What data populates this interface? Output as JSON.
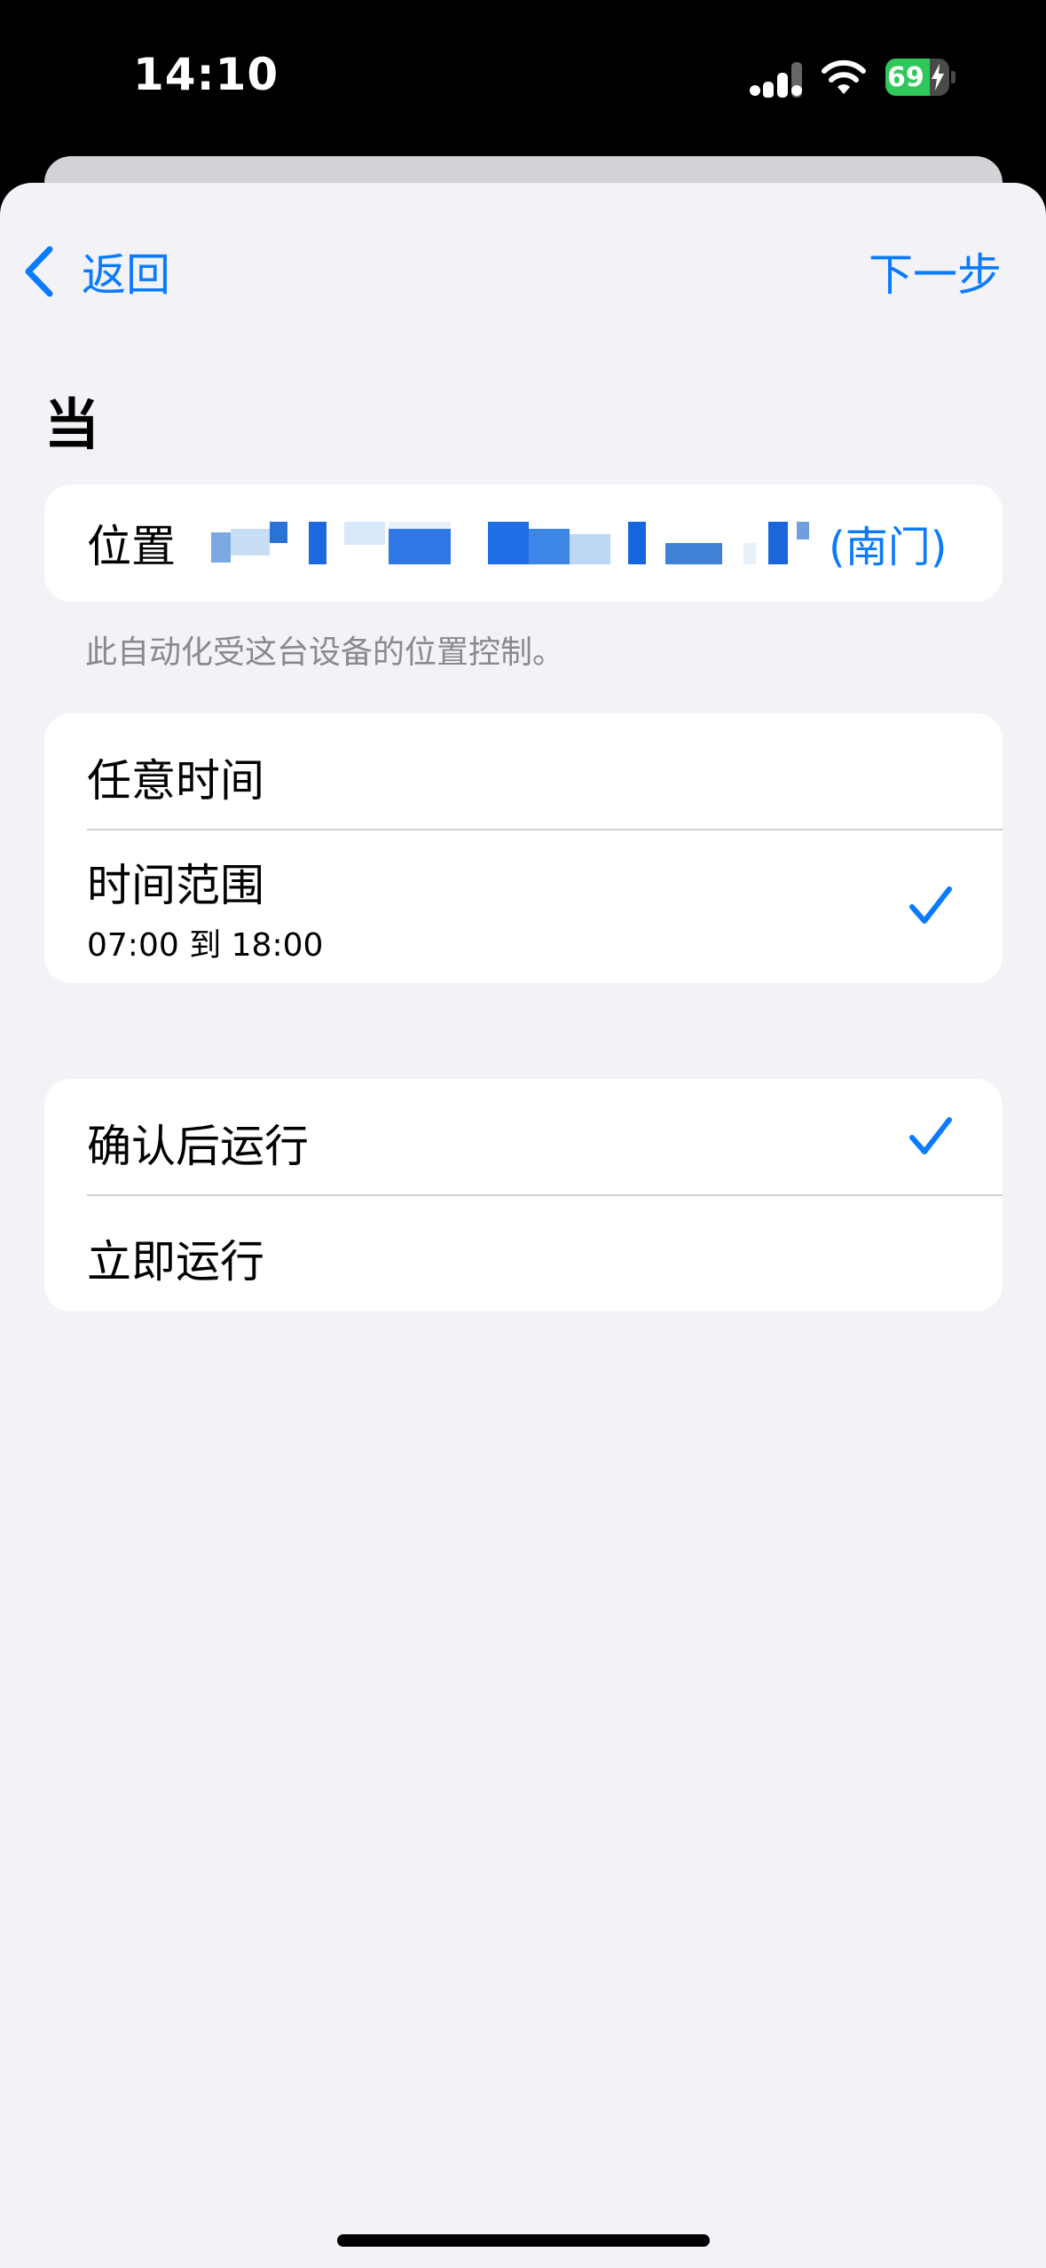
{
  "status_bar": {
    "time": "14:10",
    "battery_level": "69",
    "battery_fraction": 0.69,
    "icons": [
      "signal-icon",
      "wifi-icon",
      "battery-charging-icon"
    ]
  },
  "nav": {
    "back_label": "返回",
    "next_label": "下一步"
  },
  "section": {
    "title": "当"
  },
  "location": {
    "label": "位置",
    "value_suffix": "(南门)",
    "footnote": "此自动化受这台设备的位置控制。"
  },
  "time_options": [
    {
      "title": "任意时间",
      "selected": false
    },
    {
      "title": "时间范围",
      "subtitle": "07:00 到 18:00",
      "selected": true
    }
  ],
  "run_options": [
    {
      "title": "确认后运行",
      "selected": true
    },
    {
      "title": "立即运行",
      "selected": false
    }
  ],
  "colors": {
    "accent": "#0a7aff",
    "background": "#f2f2f7",
    "card": "#ffffff",
    "battery_green": "#30c85a"
  }
}
